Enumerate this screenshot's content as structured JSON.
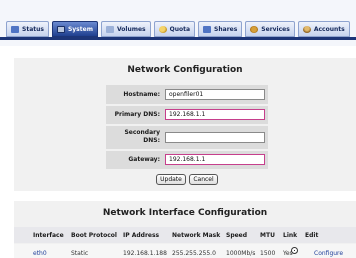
{
  "nav": {
    "tabs": [
      {
        "label": "Status",
        "icon": "status-icon",
        "active": false
      },
      {
        "label": "System",
        "icon": "system-icon",
        "active": true
      },
      {
        "label": "Volumes",
        "icon": "volumes-icon",
        "active": false
      },
      {
        "label": "Quota",
        "icon": "quota-icon",
        "active": false
      },
      {
        "label": "Shares",
        "icon": "shares-icon",
        "active": false
      },
      {
        "label": "Services",
        "icon": "services-icon",
        "active": false
      },
      {
        "label": "Accounts",
        "icon": "accounts-icon",
        "active": false
      }
    ]
  },
  "network_config": {
    "title": "Network Configuration",
    "hostname": {
      "label": "Hostname:",
      "value": "openfiler01"
    },
    "primary_dns": {
      "label": "Primary DNS:",
      "value": "192.168.1.1"
    },
    "secondary_dns": {
      "label_line1": "Secondary",
      "label_line2": "DNS:",
      "value": ""
    },
    "gateway": {
      "label": "Gateway:",
      "value": "192.168.1.1"
    },
    "update_label": "Update",
    "cancel_label": "Cancel"
  },
  "interface_config": {
    "title": "Network Interface Configuration",
    "columns": [
      "Interface",
      "Boot Protocol",
      "IP Address",
      "Network Mask",
      "Speed",
      "MTU",
      "Link",
      "Edit"
    ],
    "rows": [
      {
        "interface": "eth0",
        "boot_protocol": "Static",
        "ip_address": "192.168.1.188",
        "network_mask": "255.255.255.0",
        "speed": "1000Mb/s",
        "mtu": "1500",
        "link": "Yes",
        "edit": "Configure"
      }
    ]
  },
  "colors": {
    "active_tab": "#1f3f8f",
    "panel_bg": "#f1f1f1",
    "input_border": "#c63f8c"
  }
}
